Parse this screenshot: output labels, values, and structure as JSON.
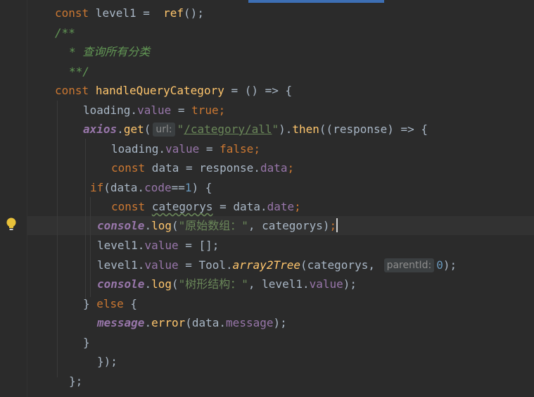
{
  "code": {
    "l1": {
      "kw": "const",
      "rest": " level1 =  ",
      "fn": "ref",
      "tail": "();"
    },
    "l2": {
      "text": "/**"
    },
    "l3": {
      "text": "* 查询所有分类"
    },
    "l4": {
      "text": "**/"
    },
    "l5": {
      "kw": "const",
      "sp": " ",
      "fn": "handleQueryCategory",
      "tail": " = () => {"
    },
    "l6": {
      "a": "loading.",
      "prop": "value",
      "b": " = ",
      "kw": "true",
      "c": ";"
    },
    "l7": {
      "obj": "axios",
      "dot": ".",
      "fn": "get",
      "paren": "(",
      "hint": "url:",
      "q1": "\"",
      "path": "/category/all",
      "q2": "\"",
      "b": ").",
      "fn2": "then",
      "c": "((response) => {"
    },
    "l8": {
      "a": "loading.",
      "prop": "value",
      "b": " = ",
      "kw": "false",
      "c": ";"
    },
    "l9": {
      "kw": "const",
      "a": " data = response.",
      "prop": "data",
      "c": ";"
    },
    "l10": {
      "kw": "if",
      "a": "(data.",
      "prop": "code",
      "b": "==",
      "num": "1",
      "c": ") {"
    },
    "l11": {
      "kw": "const",
      "sp": " ",
      "var": "categorys",
      "a": " = data.",
      "prop": "date",
      "c": ";"
    },
    "l12": {
      "obj": "console",
      "dot": ".",
      "fn": "log",
      "a": "(",
      "str": "\"原始数组：\"",
      "b": ", categorys)",
      "semi": ";"
    },
    "l13": {
      "a": "level1.",
      "prop": "value",
      "b": " = [];"
    },
    "l14": {
      "a": "level1.",
      "prop": "value",
      "b": " = Tool.",
      "fn": "array2Tree",
      "c": "(categorys, ",
      "hint": "parentId:",
      "num": "0",
      "d": ");"
    },
    "l15": {
      "obj": "console",
      "dot": ".",
      "fn": "log",
      "a": "(",
      "str": "\"树形结构：\"",
      "b": ", level1.",
      "prop": "value",
      "c": ");"
    },
    "l16": {
      "a": "} ",
      "kw": "else",
      "b": " {"
    },
    "l17": {
      "obj": "message",
      "dot": ".",
      "fn": "error",
      "a": "(data.",
      "prop": "message",
      "b": ");"
    },
    "l18": {
      "text": "}"
    },
    "l19": {
      "text": "});"
    },
    "l20": {
      "text": "};"
    }
  },
  "colors": {
    "background": "#2b2b2b",
    "keyword": "#cc7832",
    "function": "#ffc66d",
    "property": "#9876aa",
    "comment": "#629755",
    "string": "#6a8759",
    "number": "#6897bb",
    "text": "#a9b7c6"
  },
  "icons": {
    "gutter": "lightbulb-icon"
  }
}
